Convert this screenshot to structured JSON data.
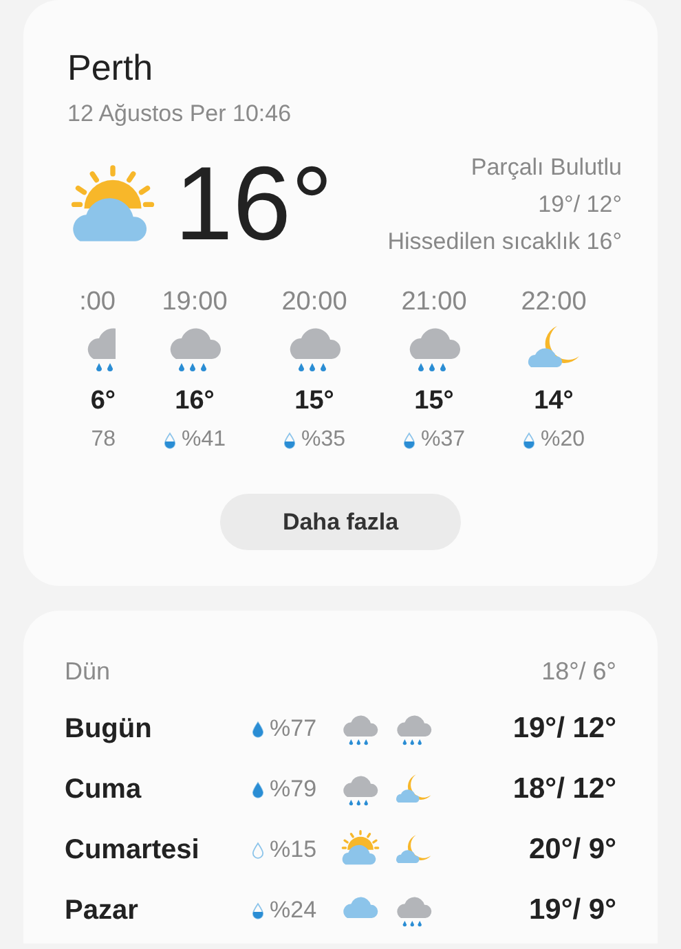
{
  "current": {
    "city": "Perth",
    "datetime": "12 Ağustos Per 10:46",
    "icon": {
      "kind": "sun-cloud"
    },
    "temp": "16°",
    "condition": "Parçalı Bulutlu",
    "high_low": "19°/ 12°",
    "feels_like": "Hissedilen sıcaklık 16°"
  },
  "hourly": [
    {
      "time": ":00",
      "icon": {
        "kind": "rain"
      },
      "temp": "6°",
      "precip": "78"
    },
    {
      "time": "19:00",
      "icon": {
        "kind": "rain"
      },
      "temp": "16°",
      "precip": "%41",
      "drop": {
        "kind": "half"
      }
    },
    {
      "time": "20:00",
      "icon": {
        "kind": "rain"
      },
      "temp": "15°",
      "precip": "%35",
      "drop": {
        "kind": "half"
      }
    },
    {
      "time": "21:00",
      "icon": {
        "kind": "rain"
      },
      "temp": "15°",
      "precip": "%37",
      "drop": {
        "kind": "half"
      }
    },
    {
      "time": "22:00",
      "icon": {
        "kind": "night-cloud"
      },
      "temp": "14°",
      "precip": "%20",
      "drop": {
        "kind": "half"
      }
    }
  ],
  "more_button": "Daha fazla",
  "yesterday": {
    "label": "Dün",
    "temps": "18°/ 6°"
  },
  "daily": [
    {
      "day": "Bugün",
      "drop": {
        "kind": "full"
      },
      "precip": "%77",
      "icons": [
        {
          "kind": "rain"
        },
        {
          "kind": "rain"
        }
      ],
      "temps": "19°/ 12°"
    },
    {
      "day": "Cuma",
      "drop": {
        "kind": "full"
      },
      "precip": "%79",
      "icons": [
        {
          "kind": "rain"
        },
        {
          "kind": "night-cloud"
        }
      ],
      "temps": "18°/ 12°"
    },
    {
      "day": "Cumartesi",
      "drop": {
        "kind": "empty"
      },
      "precip": "%15",
      "icons": [
        {
          "kind": "sun-cloud"
        },
        {
          "kind": "night-cloud"
        }
      ],
      "temps": "20°/ 9°"
    },
    {
      "day": "Pazar",
      "drop": {
        "kind": "half"
      },
      "precip": "%24",
      "icons": [
        {
          "kind": "cloud"
        },
        {
          "kind": "rain"
        }
      ],
      "temps": "19°/ 9°"
    }
  ]
}
